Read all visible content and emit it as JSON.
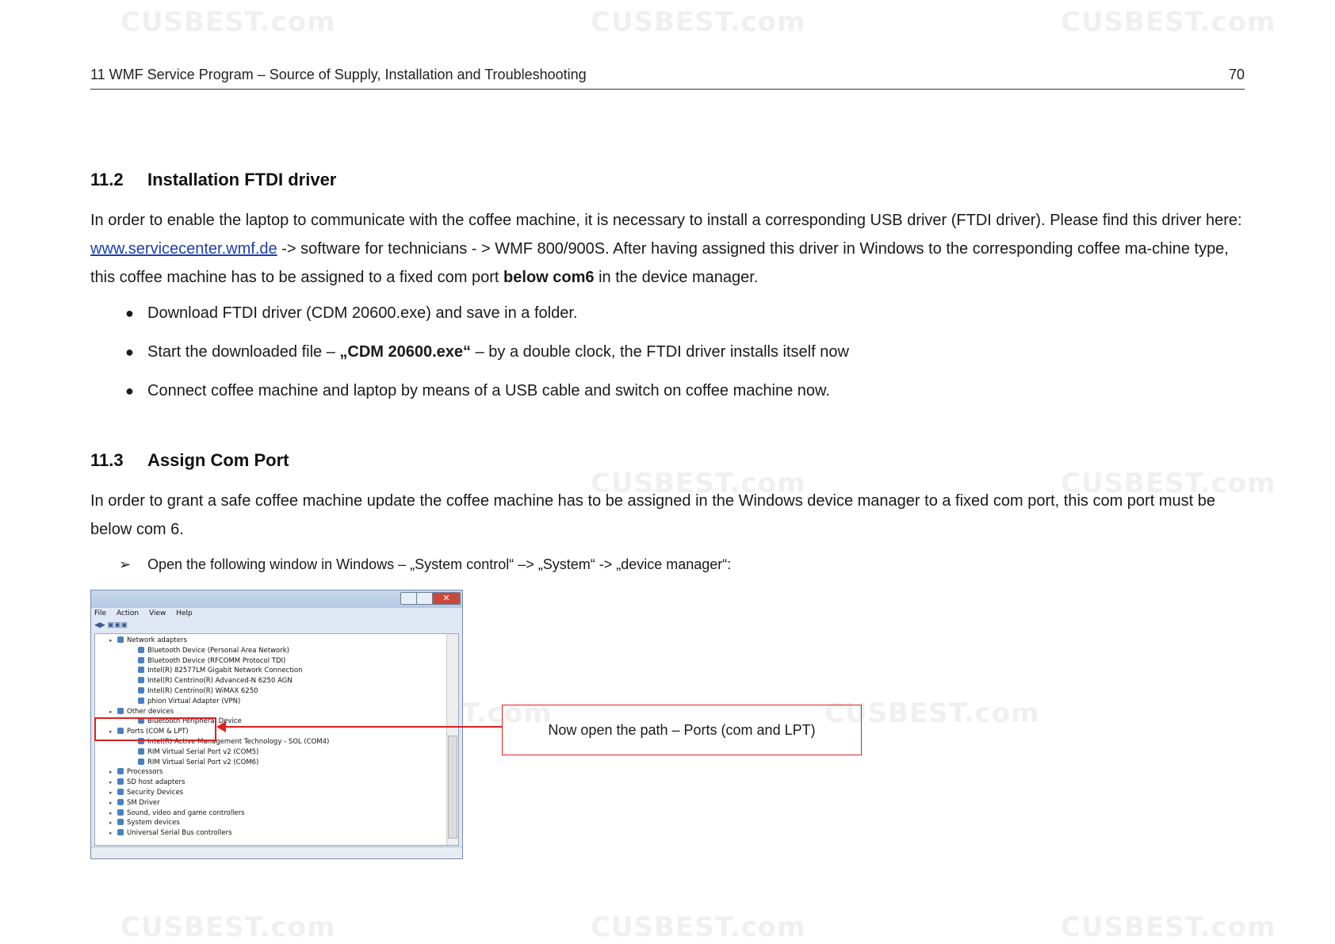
{
  "header": {
    "title": "11 WMF Service Program – Source of Supply, Installation and Troubleshooting",
    "page_number": "70"
  },
  "watermark": "CUSBEST.com",
  "section_11_2": {
    "number": "11.2",
    "title": "Installation FTDI driver",
    "para_a": "In order to enable the laptop to communicate with the coffee machine, it is necessary to install a corresponding USB driver (FTDI driver). Please find this driver here: ",
    "link": "www.servicecenter.wmf.de",
    "para_b": " -> software for technicians - > WMF 800/900S. After having assigned this driver in Windows to the corresponding coffee ma-chine type, this coffee machine has to be assigned to a fixed com port ",
    "para_bold": "below com6",
    "para_c": " in the device manager.",
    "bullets": [
      {
        "text": "Download FTDI driver (CDM 20600.exe) and save in a folder."
      },
      {
        "pre": "Start the downloaded file – ",
        "bold": "„CDM 20600.exe“",
        "post": " – by a double clock, the FTDI driver installs itself now"
      },
      {
        "text": "Connect coffee machine and laptop by means of a USB cable and switch on coffee machine now."
      }
    ]
  },
  "section_11_3": {
    "number": "11.3",
    "title": "Assign Com Port",
    "para": "In order to grant a safe coffee machine update the coffee machine has to be assigned in the Windows device manager to a fixed com port, this com port must be below com 6.",
    "arrow_item": "Open the following window in Windows – „System control“ –> „System“ -> „device manager“:"
  },
  "device_manager": {
    "menu": [
      "File",
      "Action",
      "View",
      "Help"
    ],
    "tree": [
      {
        "level": 0,
        "label": "Network adapters"
      },
      {
        "level": 1,
        "label": "Bluetooth Device (Personal Area Network)"
      },
      {
        "level": 1,
        "label": "Bluetooth Device (RFCOMM Protocol TDI)"
      },
      {
        "level": 1,
        "label": "Intel(R) 82577LM Gigabit Network Connection"
      },
      {
        "level": 1,
        "label": "Intel(R) Centrino(R) Advanced-N 6250 AGN"
      },
      {
        "level": 1,
        "label": "Intel(R) Centrino(R) WiMAX 6250"
      },
      {
        "level": 1,
        "label": "phion Virtual Adapter (VPN)"
      },
      {
        "level": 0,
        "label": "Other devices"
      },
      {
        "level": 1,
        "label": "Bluetooth Peripheral Device"
      },
      {
        "level": 0,
        "label": "Ports (COM & LPT)"
      },
      {
        "level": 1,
        "label": "Intel(R) Active Management Technology - SOL (COM4)"
      },
      {
        "level": 1,
        "label": "RIM Virtual Serial Port v2 (COM5)"
      },
      {
        "level": 1,
        "label": "RIM Virtual Serial Port v2 (COM6)"
      },
      {
        "level": 0,
        "label": "Processors"
      },
      {
        "level": 0,
        "label": "SD host adapters"
      },
      {
        "level": 0,
        "label": "Security Devices"
      },
      {
        "level": 0,
        "label": "SM Driver"
      },
      {
        "level": 0,
        "label": "Sound, video and game controllers"
      },
      {
        "level": 0,
        "label": "System devices"
      },
      {
        "level": 0,
        "label": "Universal Serial Bus controllers"
      }
    ]
  },
  "callout": "Now open the path – Ports (com and LPT)",
  "colors": {
    "highlight": "#e02020",
    "link": "#1a3fb0"
  }
}
